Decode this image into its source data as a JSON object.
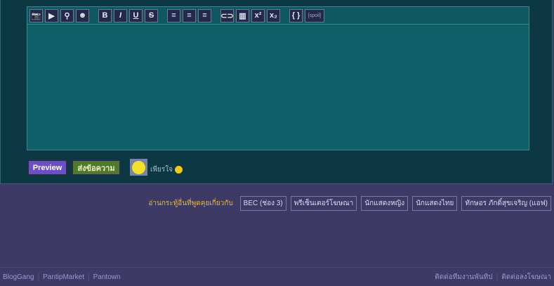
{
  "toolbar": [
    {
      "name": "image",
      "glyph": "📷"
    },
    {
      "name": "video",
      "glyph": "▶"
    },
    {
      "name": "map-pin",
      "glyph": "⚲"
    },
    {
      "name": "emoji",
      "glyph": "☻"
    },
    {
      "name": "bold",
      "glyph": "B"
    },
    {
      "name": "italic",
      "glyph": "I"
    },
    {
      "name": "underline",
      "glyph": "U"
    },
    {
      "name": "strikethrough",
      "glyph": "S"
    },
    {
      "name": "align-left",
      "glyph": "≡"
    },
    {
      "name": "align-center",
      "glyph": "≡"
    },
    {
      "name": "align-right",
      "glyph": "≡"
    },
    {
      "name": "link",
      "glyph": "⊂⊃"
    },
    {
      "name": "table",
      "glyph": "▥"
    },
    {
      "name": "superscript",
      "glyph": "x²"
    },
    {
      "name": "subscript",
      "glyph": "x₂"
    },
    {
      "name": "code",
      "glyph": "{ }"
    },
    {
      "name": "spoiler",
      "glyph": "[spoil]"
    }
  ],
  "buttons": {
    "preview": "Preview",
    "send": "ส่งข้อความ"
  },
  "mood": "เพียรใจ",
  "tags": {
    "label": "อ่านกระทู้อื่นที่พูดคุยเกี่ยวกับ",
    "items": [
      "BEC (ช่อง 3)",
      "พรีเซ็นเตอร์โฆษณา",
      "นักแสดงหญิง",
      "นักแสดงไทย",
      "ทักษอร ภักดิ์สุขเจริญ (แอฟ)"
    ]
  },
  "footer": {
    "left": [
      "BlogGang",
      "PantipMarket",
      "Pantown"
    ],
    "right": [
      "ติดต่อทีมงานพันทิป",
      "ติดต่อลงโฆษณา"
    ]
  }
}
